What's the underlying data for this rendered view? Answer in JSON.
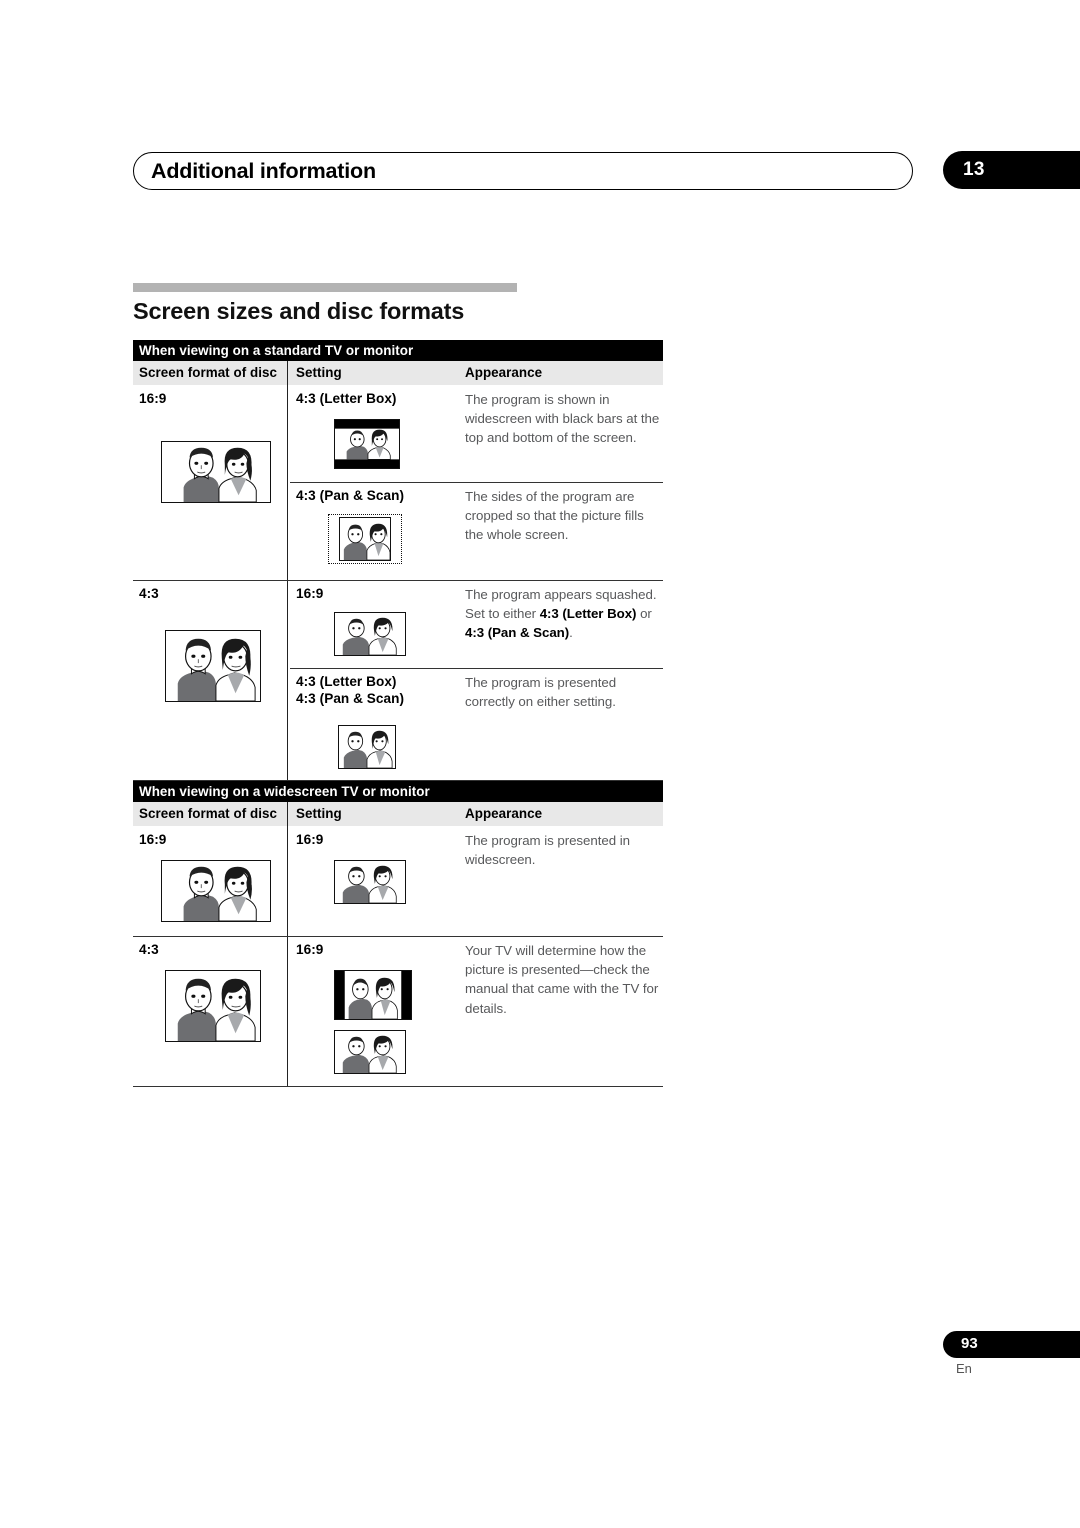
{
  "page": {
    "chapter_title": "Additional information",
    "chapter_number": "13",
    "section_heading": "Screen sizes and disc formats",
    "page_number": "93",
    "language_code": "En"
  },
  "tables": [
    {
      "band_title": "When viewing on a standard TV or monitor",
      "columns": {
        "disc": "Screen format of disc",
        "setting": "Setting",
        "appearance": "Appearance"
      },
      "groups": [
        {
          "disc_format": "16:9",
          "disc_pic": "tv-16x9-full",
          "rows": [
            {
              "setting": "4:3 (Letter Box)",
              "setting_pic": "tv-letterbox",
              "appearance": "The program is shown in widescreen with black bars at the top and bottom of the screen."
            },
            {
              "setting": "4:3 (Pan & Scan)",
              "setting_pic": "tv-panscan",
              "appearance": "The sides of the program are cropped so that the picture fills the whole screen."
            }
          ]
        },
        {
          "disc_format": "4:3",
          "disc_pic": "tv-4x3-full",
          "rows": [
            {
              "setting": "16:9",
              "setting_pic": "tv-squashed",
              "appearance_parts": [
                {
                  "text": "The program appears squashed. Set to either ",
                  "bold": false
                },
                {
                  "text": "4:3 (Letter Box)",
                  "bold": true
                },
                {
                  "text": " or ",
                  "bold": false
                },
                {
                  "text": "4:3 (Pan & Scan)",
                  "bold": true
                },
                {
                  "text": ".",
                  "bold": false
                }
              ],
              "appearance": "The program appears squashed. Set to either 4:3 (Letter Box) or 4:3 (Pan & Scan)."
            },
            {
              "setting": "4:3 (Letter Box)",
              "setting2": "4:3 (Pan & Scan)",
              "setting_pic": "tv-4x3-small",
              "appearance": "The program is presented correctly on either setting."
            }
          ]
        }
      ]
    },
    {
      "band_title": "When viewing on a widescreen TV or monitor",
      "columns": {
        "disc": "Screen format of disc",
        "setting": "Setting",
        "appearance": "Appearance"
      },
      "groups": [
        {
          "disc_format": "16:9",
          "disc_pic": "tv-16x9-full",
          "rows": [
            {
              "setting": "16:9",
              "setting_pic": "tv-16x9-small",
              "appearance": "The program is presented in widescreen."
            }
          ]
        },
        {
          "disc_format": "4:3",
          "disc_pic": "tv-4x3-full",
          "rows": [
            {
              "setting": "16:9",
              "setting_pic": "tv-pillarbox",
              "setting_pic2": "tv-16x9-small",
              "appearance": "Your TV will determine how the picture is presented—check the manual that came with the TV for details."
            }
          ]
        }
      ]
    }
  ],
  "colors": {
    "band_bg": "#000000",
    "colhead_bg": "#e8e8e8",
    "rule_grey": "#b3b3b3",
    "body_text": "#58595b"
  }
}
